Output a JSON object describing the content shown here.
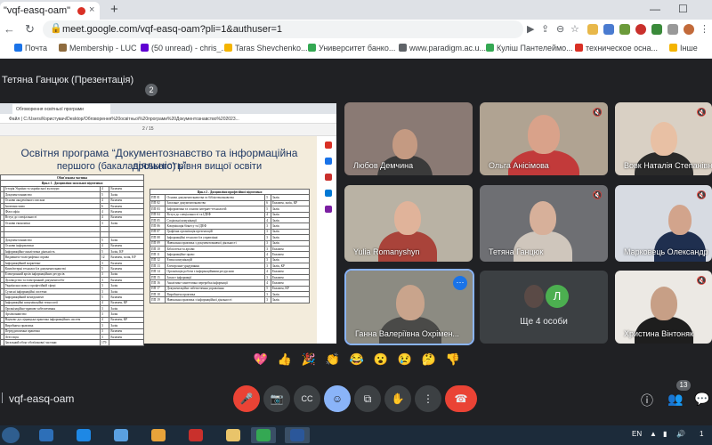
{
  "browser": {
    "tab_title": "\"vqf-easq-oam\"",
    "close_tab": "×",
    "new_tab": "+",
    "win_min": "—",
    "win_max": "☐",
    "url": "meet.google.com/vqf-easq-oam?pli=1&authuser=1"
  },
  "bookmarks": [
    {
      "label": "Почта",
      "color": "#1a73e8"
    },
    {
      "label": "Membership - LUC",
      "color": "#8e6b3e"
    },
    {
      "label": "(50 unread) - chris_...",
      "color": "#6001d2"
    },
    {
      "label": "Taras Shevchenko...",
      "color": "#f4b400"
    },
    {
      "label": "Университет банко...",
      "color": "#34a853"
    },
    {
      "label": "www.paradigm.ac.u...",
      "color": "#5f6368"
    },
    {
      "label": "Куліш Пантелеймо...",
      "color": "#34a853"
    },
    {
      "label": "техническое осна...",
      "color": "#d93025"
    },
    {
      "label": "Інше",
      "color": "#f4b400"
    }
  ],
  "meet": {
    "presenter_label": "Тетяна Ганцюк (Презентація)",
    "call_code": "vqf-easq-oam",
    "participant_count": "13",
    "more_people": "Ще 4 особи",
    "avatar_letter": "Л"
  },
  "presentation": {
    "pdf_tab": "Обговорення освітньої програми",
    "pdf_url": "Файл  |  C:/Users/Користувач/Desktop/Обговорення%20освітньої%20програми%20Документознавство%202023...",
    "pdf_page_ctrl": "2  /  15",
    "title_line1": "Освітня програма “Документознавство та інформаційна діяльність”",
    "title_line2": "першого (бакалаврського) рівня вищої освіти",
    "badge": "2",
    "left_table": {
      "header1": "Обов'язкова частина",
      "header2": "Цикл 1 . Дисципліни загальної підготовки",
      "rows": [
        [
          "",
          "Історія України та української культури",
          "4",
          "Екзамен"
        ],
        [
          "",
          "Документознавство",
          "5",
          "Залік"
        ],
        [
          "",
          "Основи академічного письма",
          "4",
          "Екзамен"
        ],
        [
          "",
          "Іноземна мова",
          "6",
          "Екзамен"
        ],
        [
          "",
          "Філософія",
          "4",
          "Екзамен"
        ],
        [
          "",
          "Вступ до спеціальності",
          "4",
          "Екзамен"
        ],
        [
          "",
          "Основи економіки",
          "3",
          "Залік"
        ],
        [
          "",
          "",
          "",
          ""
        ],
        [
          "",
          "",
          "",
          ""
        ],
        [
          "",
          "Документознавство",
          "5",
          "Залік"
        ],
        [
          "",
          "Основи інформатики",
          "4",
          "Екзамен"
        ],
        [
          "",
          "Інформаційно-аналітична діяльність",
          "5",
          "Залік, КР"
        ],
        [
          "",
          "Видавничо-поліграфічна справа",
          "12",
          "Екзамен, залік, КР"
        ],
        [
          "",
          "Інформаційний маркетинг",
          "3",
          "Екзамен"
        ],
        [
          "",
          "Комп'ютерні технології в документознавстві",
          "5",
          "Екзамен"
        ],
        [
          "",
          "Електронний архів інформаційних ресурсів",
          "3",
          "Залік"
        ],
        [
          "",
          "Діловодство та електронний документообіг",
          "3",
          "Екзамен"
        ],
        [
          "",
          "Українська мова у професійній сфері",
          "3",
          "Залік"
        ],
        [
          "",
          "Сучасні інформаційні системи",
          "3",
          "Залік"
        ],
        [
          "",
          "Інформаційний менеджмент",
          "5",
          "Екзамен"
        ],
        [
          "",
          "Інформаційні комунікаційні технології",
          "4",
          "Екзамен, КР"
        ],
        [
          "",
          "Організаційно-правове забезпечення",
          "3",
          "Залік"
        ],
        [
          "",
          "Архівознавство",
          "3",
          "Залік"
        ],
        [
          "",
          "Науково-дослідницька практика інформаційних систем",
          "4",
          "Екзамен, КР"
        ],
        [
          "",
          "Виробнича практика",
          "3",
          "Залік"
        ],
        [
          "",
          "Переддипломна практика",
          "3",
          "Екзамен"
        ],
        [
          "",
          "Атестація",
          "3",
          "Екзамен"
        ],
        [
          "",
          "Загальний обсяг обов'язкової частини",
          "179",
          ""
        ]
      ]
    },
    "right_table": {
      "header": "Цикл 2 . Дисципліни професійної підготовки",
      "rows": [
        [
          "ПП 01",
          "Основи документознавства та бібліотекознавства",
          "5",
          "Залік"
        ],
        [
          "ПП 02",
          "Загальне документознавство",
          "6",
          "Екзамен, залік, КР"
        ],
        [
          "ПП 03",
          "Інформатика та основи інтернет-технологій",
          "5",
          "Залік"
        ],
        [
          "ПП 04",
          "Вступ до спеціальності та ІДЕФ",
          "4",
          "Залік"
        ],
        [
          "ПП 05",
          "Соціальні комунікації",
          "4",
          "Залік"
        ],
        [
          "ПП 06",
          "Комунікація бізнесу та ІДЕФ",
          "3",
          "Залік"
        ],
        [
          "ПП 07",
          "Графічна організація презентацій",
          "3",
          "Залік"
        ],
        [
          "ПП 08",
          "Інформаційні технології в управлінні",
          "3",
          "Залік"
        ],
        [
          "ПП 09",
          "Навчальна практика з документознавчої діяльності",
          "3",
          "Залік"
        ],
        [
          "ПП 10",
          "Бібліотеки та архіви",
          "3",
          "Екзамен"
        ],
        [
          "ПП 11",
          "Інформаційне право",
          "4",
          "Екзамен"
        ],
        [
          "ПП 12",
          "Етика комунікацій",
          "3",
          "Залік"
        ],
        [
          "ПП 13",
          "Електронне урядування",
          "3",
          "Залік, КР"
        ],
        [
          "ПП 14",
          "Організація роботи з інформаційними ресурсами",
          "4",
          "Екзамен"
        ],
        [
          "ПП 15",
          "Захист інформації",
          "3",
          "Екзамен"
        ],
        [
          "ПП 16",
          "Аналітико-синтетична переробка інформації",
          "4",
          "Екзамен"
        ],
        [
          "ПП 17",
          "Документаційне забезпечення управління",
          "5",
          "Екзамен, КР"
        ],
        [
          "ПП 18",
          "Виробнича практика",
          "3",
          "Залік"
        ],
        [
          "ПП 19",
          "Навчальна практика з інформаційної діяльності",
          "3",
          "Залік"
        ]
      ]
    }
  },
  "participants": [
    {
      "name": "Любов Демчина",
      "bg": "#8a7a74",
      "face": "#c49a82",
      "body": "#3a3a3a",
      "mic_off": false
    },
    {
      "name": "Ольга Анісімова",
      "bg": "#b0a392",
      "face": "#d9a28a",
      "body": "#c23a3a",
      "mic_off": true
    },
    {
      "name": "Вовк Наталія Степанівна",
      "bg": "#d9d0c4",
      "face": "#e8c0a4",
      "body": "#2a2a2a",
      "mic_off": true
    },
    {
      "name": "Yulia Romanyshyn",
      "bg": "#b9b2a4",
      "face": "#e0b39a",
      "body": "#a9433a",
      "mic_off": false
    },
    {
      "name": "Тетяна Ганцюк",
      "bg": "#6e6f73",
      "face": "#d7b09a",
      "body": "#cfc6bc",
      "mic_off": true
    },
    {
      "name": "Марковець Олександр",
      "bg": "#d7dbe2",
      "face": "#d2a48c",
      "body": "#1f2f4f",
      "mic_off": true
    },
    {
      "name": "Ганна Валеріївна Охрімен...",
      "bg": "#8c8b82",
      "face": "#c9a48c",
      "body": "#4a4a48",
      "mic_off": false
    },
    {
      "name": "Христина Вінтоняк",
      "bg": "#ece9e4",
      "face": "#c79f86",
      "body": "#1e1e1e",
      "mic_off": true
    }
  ],
  "reactions": [
    "💖",
    "👍",
    "🎉",
    "👏",
    "😂",
    "😮",
    "😢",
    "🤔",
    "👎"
  ],
  "controls": {
    "mic": "🎤",
    "cam": "📷",
    "cc": "CC",
    "emoji": "☺",
    "present": "⧉",
    "hand": "✋",
    "more": "⋮",
    "end": "☎",
    "info": "ⓘ",
    "people": "👥",
    "chat": "💬"
  },
  "taskbar": {
    "lang": "EN",
    "time": "1",
    "items": [
      {
        "color": "#2d6fb8"
      },
      {
        "color": "#1e88e5"
      },
      {
        "color": "#5aa0e0"
      },
      {
        "color": "#e8a33a"
      },
      {
        "color": "#c9302c"
      },
      {
        "color": "#e9c46a"
      },
      {
        "color": "#34a853"
      },
      {
        "color": "#2b579a"
      }
    ]
  }
}
